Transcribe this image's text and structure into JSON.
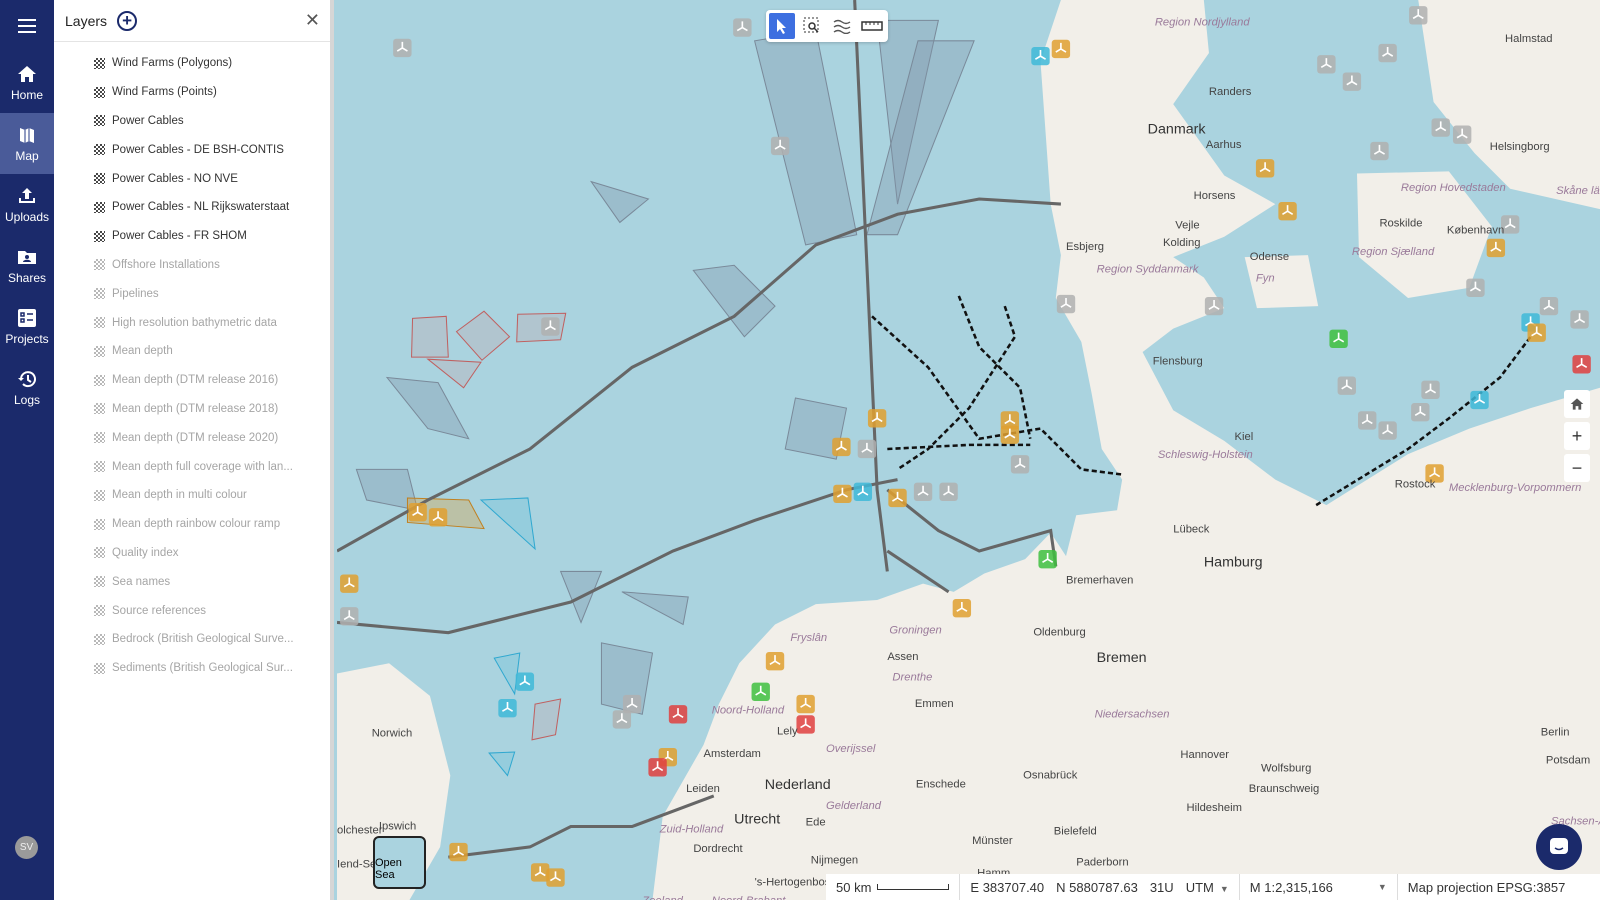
{
  "nav": {
    "items": [
      {
        "label": "Home",
        "icon": "home-icon"
      },
      {
        "label": "Map",
        "icon": "map-icon",
        "active": true
      },
      {
        "label": "Uploads",
        "icon": "upload-icon"
      },
      {
        "label": "Shares",
        "icon": "shared-folder-icon"
      },
      {
        "label": "Projects",
        "icon": "projects-icon"
      },
      {
        "label": "Logs",
        "icon": "history-icon"
      }
    ],
    "avatar": "SV"
  },
  "panel": {
    "title": "Layers",
    "layers": [
      {
        "label": "Wind Farms (Polygons)",
        "enabled": true
      },
      {
        "label": "Wind Farms (Points)",
        "enabled": true
      },
      {
        "label": "Power Cables",
        "enabled": true
      },
      {
        "label": "Power Cables - DE BSH-CONTIS",
        "enabled": true
      },
      {
        "label": "Power Cables - NO NVE",
        "enabled": true
      },
      {
        "label": "Power Cables - NL Rijkswaterstaat",
        "enabled": true
      },
      {
        "label": "Power Cables - FR SHOM",
        "enabled": true
      },
      {
        "label": "Offshore Installations",
        "enabled": false
      },
      {
        "label": "Pipelines",
        "enabled": false
      },
      {
        "label": "High resolution bathymetric data",
        "enabled": false
      },
      {
        "label": "Mean depth",
        "enabled": false
      },
      {
        "label": "Mean depth (DTM release 2016)",
        "enabled": false
      },
      {
        "label": "Mean depth (DTM release 2018)",
        "enabled": false
      },
      {
        "label": "Mean depth (DTM release 2020)",
        "enabled": false
      },
      {
        "label": "Mean depth full coverage with lan...",
        "enabled": false
      },
      {
        "label": "Mean depth in multi colour",
        "enabled": false
      },
      {
        "label": "Mean depth rainbow colour ramp",
        "enabled": false
      },
      {
        "label": "Quality index",
        "enabled": false
      },
      {
        "label": "Sea names",
        "enabled": false
      },
      {
        "label": "Source references",
        "enabled": false
      },
      {
        "label": "Bedrock (British Geological Surve...",
        "enabled": false
      },
      {
        "label": "Sediments (British Geological Sur...",
        "enabled": false
      }
    ]
  },
  "toolbar": {
    "tools": [
      "select-pointer",
      "box-select",
      "layers-waves",
      "measure-ruler"
    ],
    "active": "select-pointer"
  },
  "map": {
    "places": [
      "Danmark",
      "Region Nordjylland",
      "Randers",
      "Aarhus",
      "Horsens",
      "Vejle",
      "Kolding",
      "Esbjerg",
      "Odense",
      "Fyn",
      "Region Syddanmark",
      "Region Sjælland",
      "Region Hovedstaden",
      "Roskilde",
      "København",
      "Helsingborg",
      "Halmstad",
      "Skåne län",
      "Flensburg",
      "Kiel",
      "Schleswig-Holstein",
      "Lübeck",
      "Rostock",
      "Mecklenburg-Vorpommern",
      "Hamburg",
      "Bremerhaven",
      "Bremen",
      "Oldenburg",
      "Groningen",
      "Assen",
      "Drenthe",
      "Emmen",
      "Fryslân",
      "Noord-Holland",
      "Lely",
      "Amsterdam",
      "Leiden",
      "Nederland",
      "Overijssel",
      "Enschede",
      "Osnabrück",
      "Niedersachsen",
      "Hannover",
      "Wolfsburg",
      "Braunschweig",
      "Hildesheim",
      "Berlin",
      "Potsdam",
      "Bielefeld",
      "Münster",
      "Hamm",
      "Paderborn",
      "Sachsen-Anhalt",
      "Utrecht",
      "Gelderland",
      "Ede",
      "Zuid-Holland",
      "Dordrecht",
      "Nijmegen",
      "'s-Hertogenbosch",
      "Noord-Brabant",
      "Zeeland",
      "Norwich",
      "Ipswich",
      "olchester",
      "Iend-Sea"
    ],
    "colors": {
      "water": "#aad3df",
      "land": "#f2efe9",
      "cable": "#666666",
      "dashed_cable": "#111111",
      "windfarm_orange": "#e0a030",
      "windfarm_gray": "#b0b0b0",
      "windfarm_blue": "#40b8d8",
      "windfarm_green": "#40c040",
      "windfarm_red": "#e04040"
    }
  },
  "basemap": {
    "label": "Open Sea"
  },
  "status": {
    "scale": "50 km",
    "easting": "E 383707.40",
    "northing": "N 5880787.63",
    "zone": "31U",
    "crs": "UTM",
    "map_scale": "M 1:2,315,166",
    "projection": "Map projection EPSG:3857"
  }
}
